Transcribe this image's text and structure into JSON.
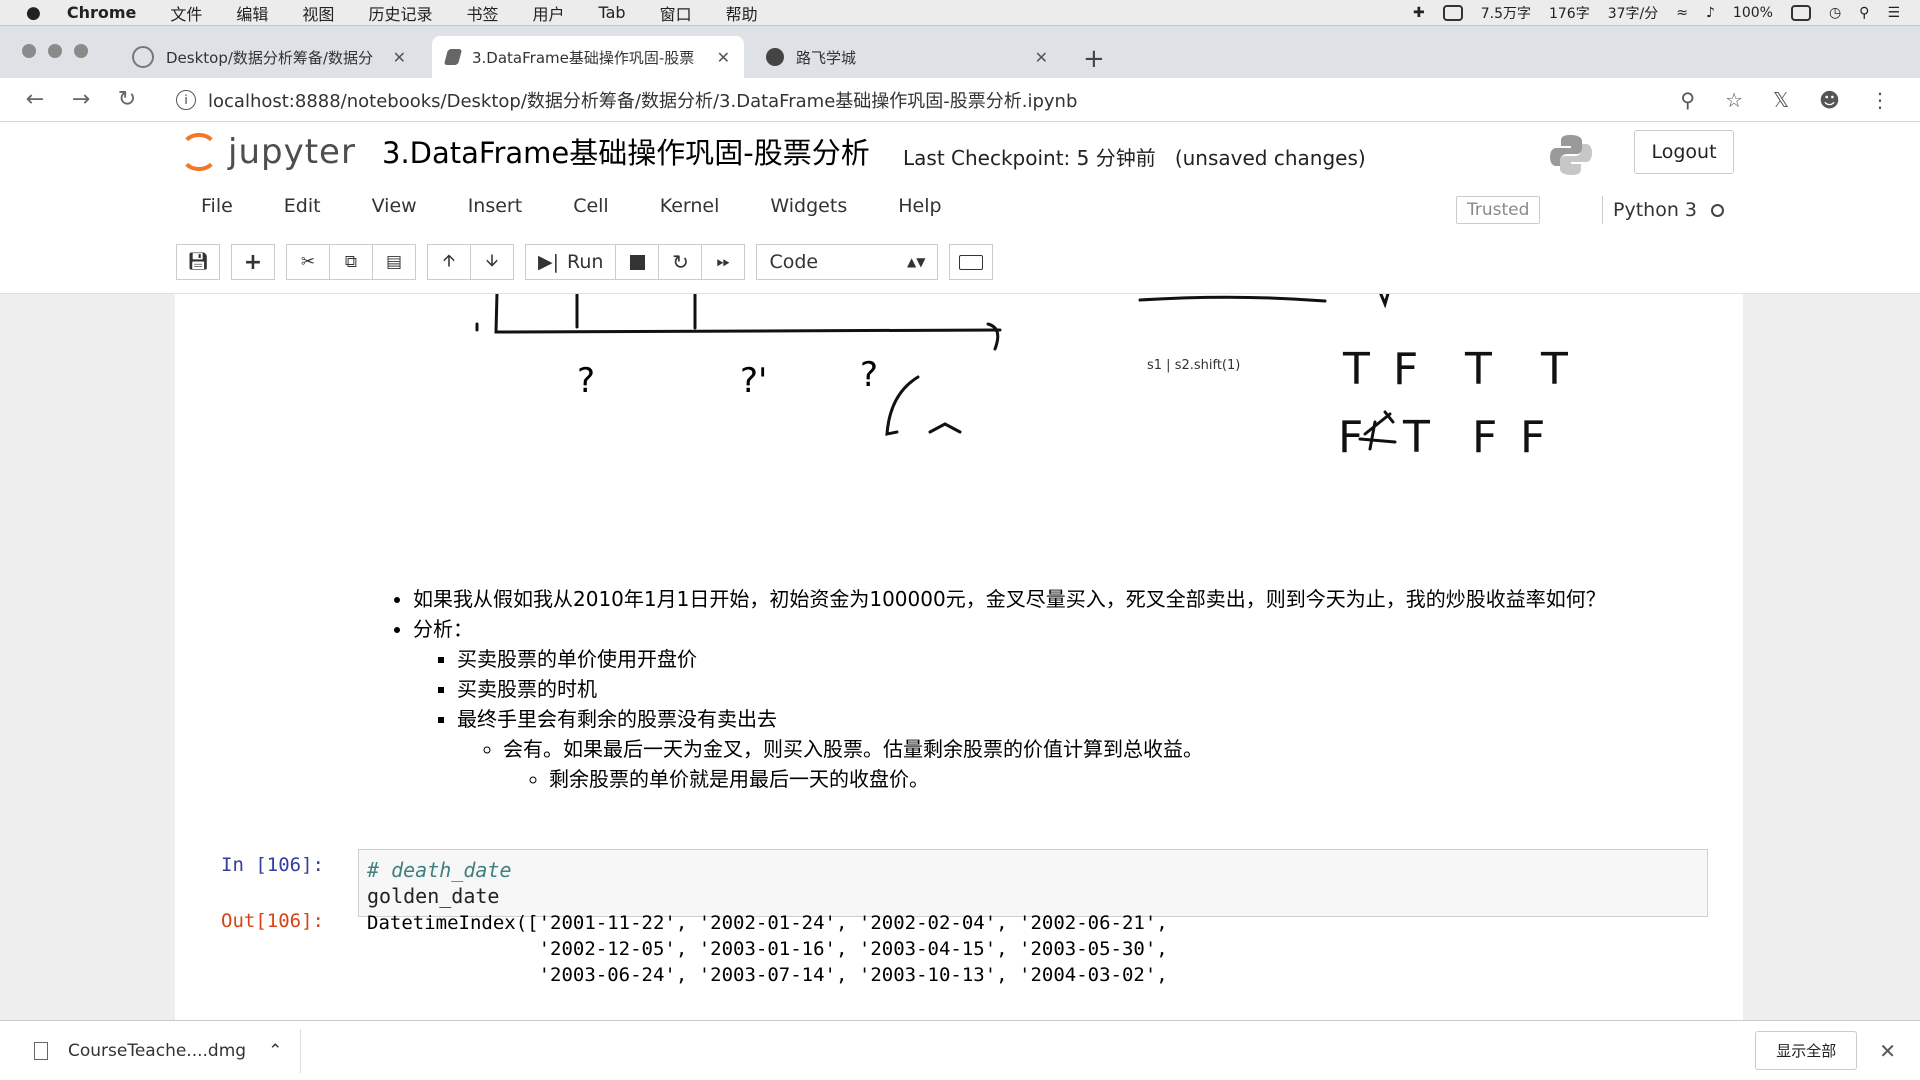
{
  "macos_menu": {
    "apple": "",
    "app_name": "Chrome",
    "items": [
      "文件",
      "编辑",
      "视图",
      "历史记录",
      "书签",
      "用户",
      "Tab",
      "窗口",
      "帮助"
    ],
    "status": [
      "7.5万字",
      "176字",
      "37字/分",
      "100%"
    ]
  },
  "tabs": [
    {
      "title": "Desktop/数据分析筹备/数据分",
      "active": false
    },
    {
      "title": "3.DataFrame基础操作巩固-股票",
      "active": true
    },
    {
      "title": "路飞学城",
      "active": false
    }
  ],
  "address": {
    "url": "localhost:8888/notebooks/Desktop/数据分析筹备/数据分析/3.DataFrame基础操作巩固-股票分析.ipynb"
  },
  "jupyter": {
    "logo_text": "jupyter",
    "notebook_title": "3.DataFrame基础操作巩固-股票分析",
    "checkpoint": "Last Checkpoint: 5 分钟前",
    "unsaved": "(unsaved changes)",
    "logout": "Logout",
    "menu": [
      "File",
      "Edit",
      "View",
      "Insert",
      "Cell",
      "Kernel",
      "Widgets",
      "Help"
    ],
    "trusted": "Trusted",
    "kernel_name": "Python 3",
    "run_label": "Run",
    "cell_type": "Code"
  },
  "drawing": {
    "note": "s1 | s2.shift(1)",
    "row1": [
      "T",
      "F",
      "T",
      "T"
    ],
    "row2": [
      "F",
      "T",
      "F",
      "F"
    ],
    "question_marks": [
      "?",
      "?'",
      "?"
    ]
  },
  "markdown": {
    "bullet1": "如果我从假如我从2010年1月1日开始，初始资金为100000元，金叉尽量买入，死叉全部卖出，则到今天为止，我的炒股收益率如何？",
    "bullet2": "分析：",
    "sub1": "买卖股票的单价使用开盘价",
    "sub2": "买卖股票的时机",
    "sub3": "最终手里会有剩余的股票没有卖出去",
    "subsub1": "会有。如果最后一天为金叉，则买入股票。估量剩余股票的价值计算到总收益。",
    "subsubsub1": "剩余股票的单价就是用最后一天的收盘价。"
  },
  "cell": {
    "in_prompt": "In [106]:",
    "comment": "# death_date",
    "code": "golden_date",
    "out_prompt": "Out[106]:",
    "output_lines": [
      "DatetimeIndex(['2001-11-22', '2002-01-24', '2002-02-04', '2002-06-21',",
      "               '2002-12-05', '2003-01-16', '2003-04-15', '2003-05-30',",
      "               '2003-06-24', '2003-07-14', '2003-10-13', '2004-03-02',"
    ]
  },
  "download": {
    "filename": "CourseTeache....dmg",
    "show_all": "显示全部"
  }
}
